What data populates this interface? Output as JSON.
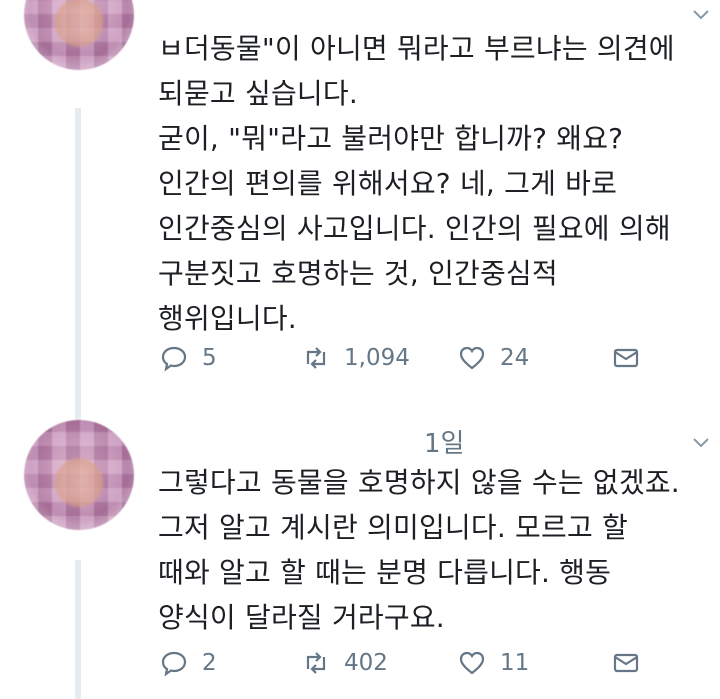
{
  "tweets": [
    {
      "time": "",
      "text": "ㅂ더동물\"이 아니면 뭐라고 부르냐는 의견에\n되묻고 싶습니다.\n굳이, \"뭐\"라고 불러야만 합니까? 왜요?\n인간의 편의를 위해서요? 네, 그게 바로\n인간중심의 사고입니다. 인간의 필요에 의해\n구분짓고 호명하는 것, 인간중심적\n행위입니다.",
      "replies": "5",
      "retweets": "1,094",
      "likes": "24"
    },
    {
      "time": "1일",
      "text": "그렇다고 동물을 호명하지 않을 수는 없겠죠.\n그저 알고 계시란 의미입니다. 모르고 할\n때와 알고 할 때는 분명 다릅니다. 행동\n양식이 달라질 거라구요.",
      "replies": "2",
      "retweets": "402",
      "likes": "11"
    }
  ],
  "icons": {
    "reply": "speech-bubble",
    "retweet": "retweet-arrows",
    "like": "heart-outline",
    "dm": "envelope",
    "more": "chevron-down"
  }
}
